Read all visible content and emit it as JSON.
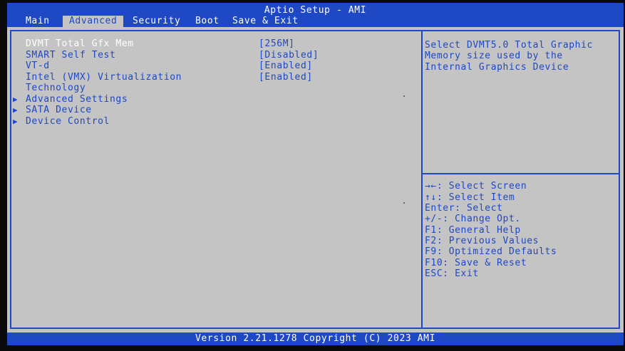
{
  "header": {
    "title": "Aptio Setup - AMI",
    "tabs": [
      {
        "label": "Main"
      },
      {
        "label": "Advanced"
      },
      {
        "label": "Security"
      },
      {
        "label": "Boot"
      },
      {
        "label": "Save & Exit"
      }
    ],
    "active_tab": "Advanced"
  },
  "settings": [
    {
      "label": "DVMT Total Gfx Mem",
      "value": "[256M]",
      "selected": true
    },
    {
      "label": "SMART Self Test",
      "value": "[Disabled]"
    },
    {
      "label": "VT-d",
      "value": "[Enabled]"
    },
    {
      "label": "Intel (VMX) Virtualization",
      "label_line2": "Technology",
      "value": "[Enabled]"
    }
  ],
  "submenus": [
    {
      "label": "Advanced Settings",
      "icon": "right-triangle"
    },
    {
      "label": "SATA Device",
      "icon": "right-triangle"
    },
    {
      "label": "Device Control",
      "icon": "right-triangle"
    }
  ],
  "help": {
    "lines": [
      "Select DVMT5.0 Total Graphic",
      "Memory size used by the",
      "Internal Graphics Device"
    ]
  },
  "keys": [
    "→←: Select Screen",
    "↑↓: Select Item",
    "Enter: Select",
    "+/-: Change Opt.",
    "F1: General Help",
    "F2: Previous Values",
    "F9: Optimized Defaults",
    "F10: Save & Reset",
    "ESC: Exit"
  ],
  "footer": {
    "version": "Version 2.21.1278 Copyright (C) 2023 AMI"
  },
  "colors": {
    "background": "#c4c4c4",
    "accent": "#1e48c4",
    "highlight_text": "#ffffff"
  }
}
